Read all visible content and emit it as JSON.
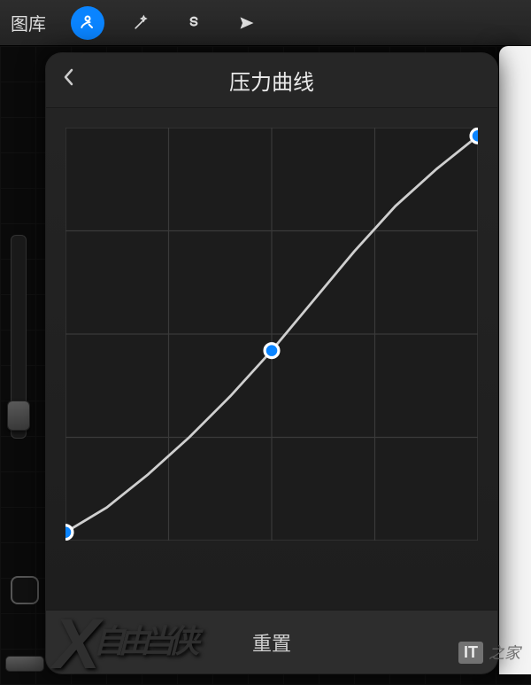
{
  "toolbar": {
    "gallery_label": "图库",
    "buttons": [
      "settings",
      "magic",
      "s-stroke",
      "share"
    ],
    "active_button": "settings"
  },
  "panel": {
    "title": "压力曲线",
    "back_label": "返回",
    "reset_label": "重置"
  },
  "sidebar": {
    "top_slider_value": 0.85,
    "checkbox_checked": false
  },
  "watermark": {
    "box": "IT",
    "suffix": "之家",
    "faint": "X 自由当侠"
  },
  "chart_data": {
    "type": "line",
    "title": "压力曲线",
    "xlabel": "",
    "ylabel": "",
    "xlim": [
      0,
      1
    ],
    "ylim": [
      0,
      1
    ],
    "grid": true,
    "grid_divisions": 4,
    "control_points": [
      {
        "x": 0.0,
        "y": 0.02
      },
      {
        "x": 0.5,
        "y": 0.46
      },
      {
        "x": 1.0,
        "y": 0.98
      }
    ],
    "series": [
      {
        "name": "pressure",
        "x": [
          0.0,
          0.1,
          0.2,
          0.3,
          0.4,
          0.5,
          0.6,
          0.7,
          0.8,
          0.9,
          1.0
        ],
        "values": [
          0.02,
          0.08,
          0.16,
          0.25,
          0.35,
          0.46,
          0.58,
          0.7,
          0.81,
          0.9,
          0.98
        ]
      }
    ]
  }
}
